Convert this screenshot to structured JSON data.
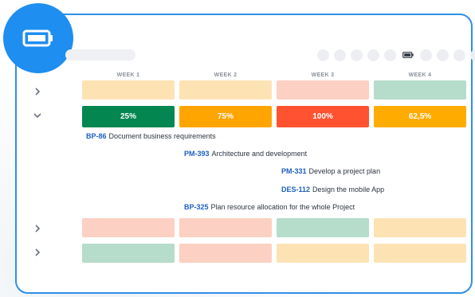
{
  "badge_icon": "battery-icon",
  "header_icon": "battery-small-icon",
  "weeks": [
    "WEEK 1",
    "WEEK 2",
    "WEEK 3",
    "WEEK 4"
  ],
  "rows": {
    "row1": {
      "expand_icon": "chevron-right-icon",
      "cells": [
        "#fde3b4",
        "#fde3b4",
        "#fcd0c2",
        "#b6dccb"
      ]
    },
    "row2": {
      "expand_icon": "chevron-down-icon",
      "utilization": [
        {
          "value": "25%",
          "color": "#03864f"
        },
        {
          "value": "75%",
          "color": "#ffa502"
        },
        {
          "value": "100%",
          "color": "#ff5230"
        },
        {
          "value": "62,5%",
          "color": "#ffab00"
        }
      ]
    },
    "row3": {
      "expand_icon": "chevron-right-icon",
      "cells": [
        "#fcd0c2",
        "#fcd0c2",
        "#b6dccb",
        "#fde3b4"
      ]
    },
    "row4": {
      "expand_icon": "chevron-right-icon",
      "cells": [
        "#b6dccb",
        "#fcd0c2",
        "#fde3b4",
        "#fde3b4"
      ]
    }
  },
  "tasks": [
    {
      "key": "BP-86",
      "title": "Document business requirements"
    },
    {
      "key": "PM-393",
      "title": "Architecture and development"
    },
    {
      "key": "PM-331",
      "title": "Develop a project plan"
    },
    {
      "key": "DES-112",
      "title": "Design the mobile App"
    },
    {
      "key": "BP-325",
      "title": "Plan resource allocation for the whole Project"
    }
  ],
  "colors": {
    "accent": "#1e8ef0",
    "border": "#2f8fe6",
    "issue_key": "#1f5fbf"
  }
}
